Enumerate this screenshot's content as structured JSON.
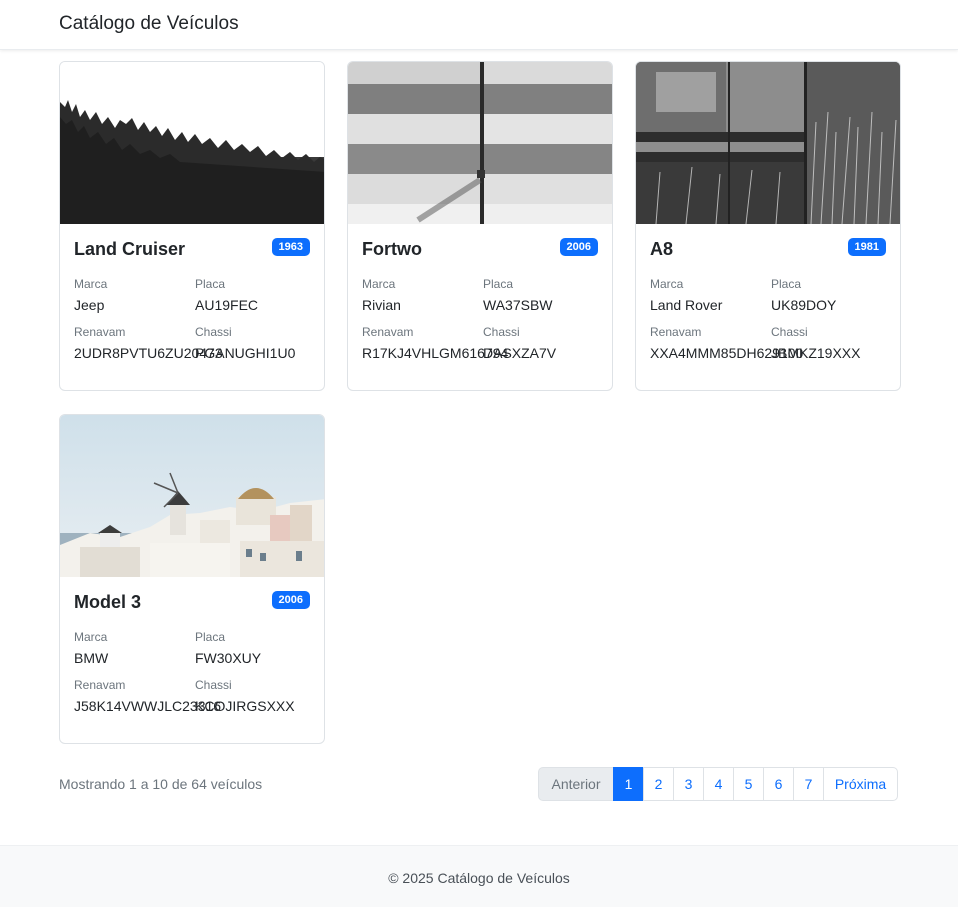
{
  "navbar": {
    "brand": "Catálogo de Veículos"
  },
  "labels": {
    "marca": "Marca",
    "placa": "Placa",
    "renavam": "Renavam",
    "chassi": "Chassi"
  },
  "vehicles": [
    {
      "model": "Land Cruiser",
      "year": "1963",
      "marca": "Jeep",
      "placa": "AU19FEC",
      "renavam": "2UDR8PVTU6ZU20473",
      "chassi": "PGANUGHI1U0",
      "image": "forest-treeline-grayscale"
    },
    {
      "model": "Fortwo",
      "year": "2006",
      "marca": "Rivian",
      "placa": "WA37SBW",
      "renavam": "R17KJ4VHLGM616794",
      "chassi": "DASXZA7V",
      "image": "striped-wall-grayscale"
    },
    {
      "model": "A8",
      "year": "1981",
      "marca": "Land Rover",
      "placa": "UK89DOY",
      "renavam": "XXA4MMM85DH629100",
      "chassi": "JBMKZ19XXX",
      "image": "lake-grass-grayscale"
    },
    {
      "model": "Model 3",
      "year": "2006",
      "marca": "BMW",
      "placa": "FW30XUY",
      "renavam": "J58K14VWWJLC23316",
      "chassi": "KCOJIRGSXXX",
      "image": "santorini-windmill"
    }
  ],
  "pagination": {
    "summary": "Mostrando 1 a 10 de 64 veículos",
    "previous": "Anterior",
    "pages": [
      "1",
      "2",
      "3",
      "4",
      "5",
      "6",
      "7"
    ],
    "active_page": "1",
    "next": "Próxima"
  },
  "footer": {
    "text": "© 2025 Catálogo de Veículos"
  },
  "colors": {
    "accent": "#0d6efd",
    "muted": "#6c757d",
    "footer_bg": "#f8f9fa"
  }
}
